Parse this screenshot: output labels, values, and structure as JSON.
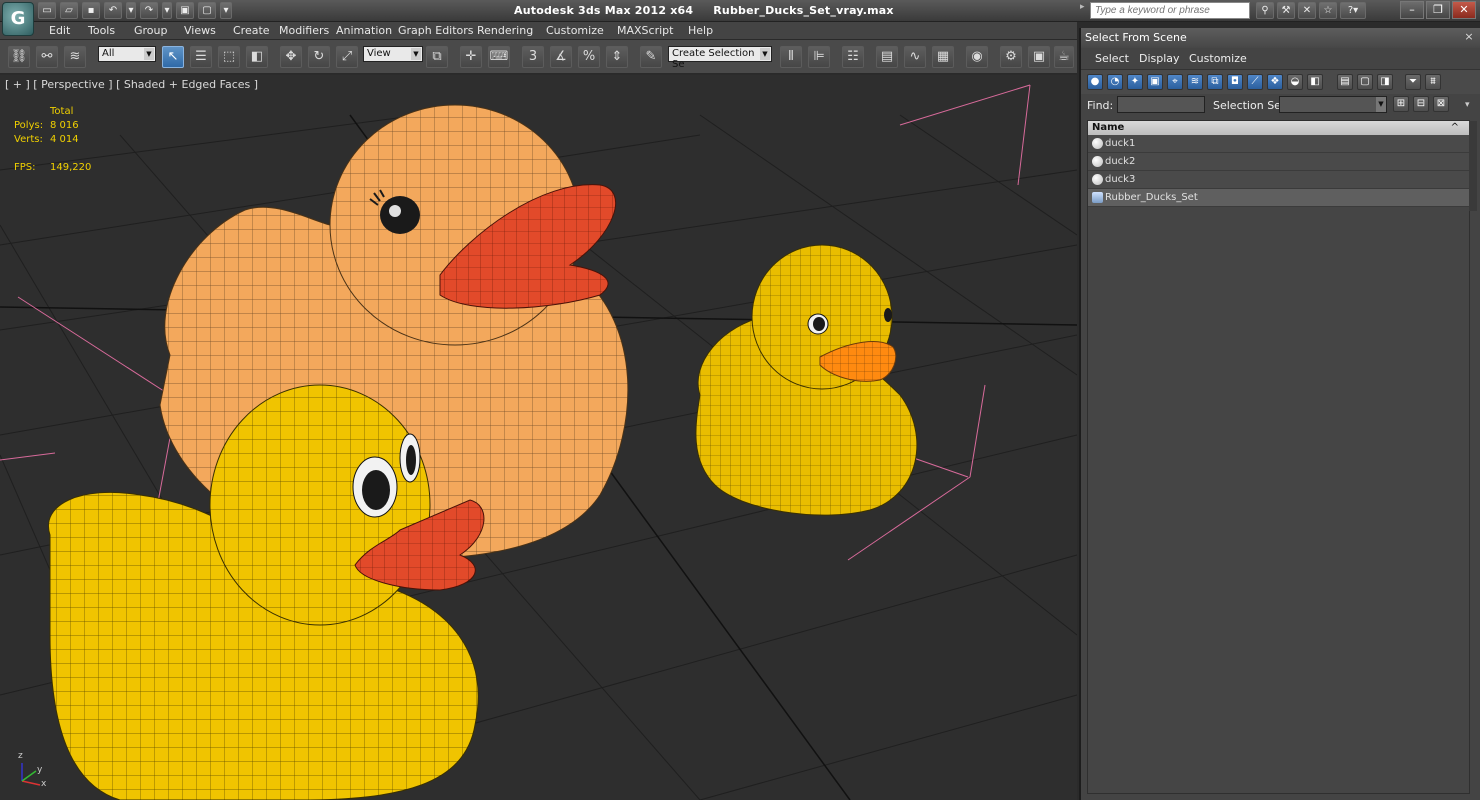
{
  "app": {
    "logo_glyph": "G",
    "title": "Autodesk 3ds Max  2012 x64",
    "filename": "Rubber_Ducks_Set_vray.max",
    "search_placeholder": "Type a keyword or phrase"
  },
  "menu": [
    "Edit",
    "Tools",
    "Group",
    "Views",
    "Create",
    "Modifiers",
    "Animation",
    "Graph Editors",
    "Rendering",
    "Customize",
    "MAXScript",
    "Help"
  ],
  "toolbar": {
    "filter_value": "All",
    "refcoord_value": "View",
    "selection_set_value": "Create Selection Se",
    "snap_labels": [
      "3",
      "%"
    ]
  },
  "viewport": {
    "label": "[ + ] [ Perspective ] [ Shaded + Edged Faces ]",
    "stats": {
      "total_label": "Total",
      "polys_label": "Polys:",
      "polys_value": "8 016",
      "verts_label": "Verts:",
      "verts_value": "4 014",
      "fps_label": "FPS:",
      "fps_value": "149,220"
    },
    "axis_labels": {
      "x": "x",
      "y": "y",
      "z": "z"
    }
  },
  "scene_panel": {
    "title": "Select From Scene",
    "menu": [
      "Select",
      "Display",
      "Customize"
    ],
    "find_label": "Find:",
    "selection_set_label": "Selection Set:",
    "column_name": "Name",
    "sort_glyph": "^",
    "items": [
      {
        "name": "duck1",
        "type": "geometry"
      },
      {
        "name": "duck2",
        "type": "geometry"
      },
      {
        "name": "duck3",
        "type": "geometry"
      },
      {
        "name": "Rubber_Ducks_Set",
        "type": "group"
      }
    ]
  },
  "colors": {
    "viewport_bg": "#2e2e2e",
    "duck_orange": "#f3a85c",
    "duck_yellow": "#f0c400",
    "beak_red": "#e24a2a",
    "selection_highlight": "#2f6aa8",
    "stats_text": "#f0d000"
  }
}
